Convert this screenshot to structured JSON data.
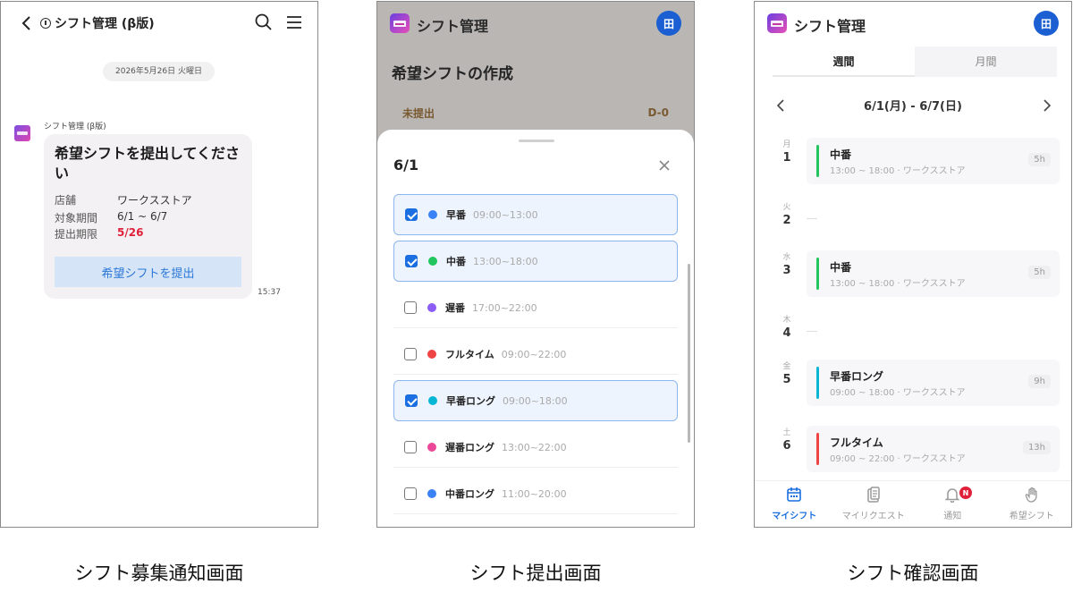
{
  "notification": {
    "header_title": "シフト管理 (β版)",
    "date_chip": "2026年5月26日 火曜日",
    "sender": "シフト管理 (β版)",
    "message_title": "希望シフトを提出してください",
    "rows": [
      {
        "key": "店舗",
        "value": "ワークスストア"
      },
      {
        "key": "対象期間",
        "value": "6/1 ~ 6/7"
      },
      {
        "key": "提出期限",
        "value": "5/26"
      }
    ],
    "button_label": "希望シフトを提出",
    "time": "15:37",
    "caption": "シフト募集通知画面"
  },
  "submit": {
    "app_title": "シフト管理",
    "user_initial": "田",
    "page_title": "希望シフトの作成",
    "status_label": "未提出",
    "status_badge": "D-0",
    "sheet_date": "6/1",
    "options": [
      {
        "name": "早番",
        "time": "09:00~13:00",
        "checked": true,
        "color": "#3b82f6"
      },
      {
        "name": "中番",
        "time": "13:00~18:00",
        "checked": true,
        "color": "#22c55e"
      },
      {
        "name": "遅番",
        "time": "17:00~22:00",
        "checked": false,
        "color": "#8b5cf6"
      },
      {
        "name": "フルタイム",
        "time": "09:00~22:00",
        "checked": false,
        "color": "#ef4444"
      },
      {
        "name": "早番ロング",
        "time": "09:00~18:00",
        "checked": true,
        "color": "#06b6d4"
      },
      {
        "name": "遅番ロング",
        "time": "13:00~22:00",
        "checked": false,
        "color": "#ec4899"
      },
      {
        "name": "中番ロング",
        "time": "11:00~20:00",
        "checked": false,
        "color": "#3b82f6"
      }
    ],
    "caption": "シフト提出画面"
  },
  "confirm": {
    "app_title": "シフト管理",
    "user_initial": "田",
    "tabs": [
      "週間",
      "月間"
    ],
    "week_label": "6/1(月) - 6/7(日)",
    "days": [
      {
        "weekday": "月",
        "day": "1",
        "shift": {
          "name": "中番",
          "detail": "13:00 ~ 18:00 · ワークスストア",
          "hours": "5h",
          "color": "#22c55e"
        }
      },
      {
        "weekday": "火",
        "day": "2",
        "shift": null
      },
      {
        "weekday": "水",
        "day": "3",
        "shift": {
          "name": "中番",
          "detail": "13:00 ~ 18:00 · ワークスストア",
          "hours": "5h",
          "color": "#22c55e"
        }
      },
      {
        "weekday": "木",
        "day": "4",
        "shift": null
      },
      {
        "weekday": "金",
        "day": "5",
        "shift": {
          "name": "早番ロング",
          "detail": "09:00 ~ 18:00 · ワークスストア",
          "hours": "9h",
          "color": "#06b6d4"
        }
      },
      {
        "weekday": "土",
        "day": "6",
        "shift": {
          "name": "フルタイム",
          "detail": "09:00 ~ 22:00 · ワークスストア",
          "hours": "13h",
          "color": "#ef4444"
        }
      }
    ],
    "nav": [
      {
        "label": "マイシフト",
        "icon": "calendar-icon",
        "active": true
      },
      {
        "label": "マイリクエスト",
        "icon": "clipboard-icon",
        "active": false
      },
      {
        "label": "通知",
        "icon": "bell-icon",
        "active": false,
        "badge": "N"
      },
      {
        "label": "希望シフト",
        "icon": "hand-icon",
        "active": false
      }
    ],
    "caption": "シフト確認画面"
  }
}
